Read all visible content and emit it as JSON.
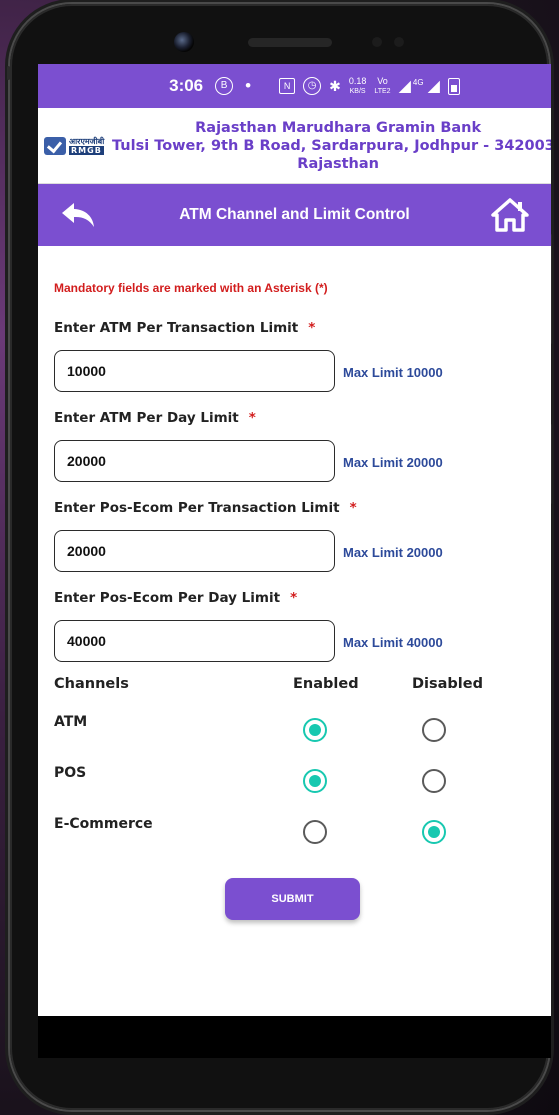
{
  "statusbar": {
    "time": "3:06",
    "b_icon": "B",
    "dot": "•",
    "icons": [
      "nfc-icon",
      "alarm-icon",
      "bluetooth-icon",
      "data-speed",
      "volte-icon",
      "signal-icon",
      "battery-icon"
    ],
    "speed_value": "0.18",
    "speed_unit": "KB/S",
    "volte_top": "Vo",
    "volte_bottom": "LTE2",
    "network": "4G"
  },
  "bank": {
    "logo_hindi": "आरएमजीबी",
    "logo_text": "RMGB",
    "name": "Rajasthan Marudhara Gramin Bank",
    "address_line1": "Tulsi Tower, 9th B Road, Sardarpura, Jodhpur - 342003,",
    "address_line2": "Rajasthan"
  },
  "topbar": {
    "title": "ATM Channel and Limit Control"
  },
  "form": {
    "mandatory_note": "Mandatory fields are marked with an Asterisk (*)",
    "asterisk": "*",
    "fields": [
      {
        "label": "Enter ATM Per Transaction Limit",
        "value": "10000",
        "max_limit": "Max Limit 10000"
      },
      {
        "label": "Enter ATM Per Day Limit",
        "value": "20000",
        "max_limit": "Max Limit 20000"
      },
      {
        "label": "Enter Pos-Ecom Per Transaction Limit",
        "value": "20000",
        "max_limit": "Max Limit 20000"
      },
      {
        "label": "Enter Pos-Ecom Per Day Limit",
        "value": "40000",
        "max_limit": "Max Limit 40000"
      }
    ]
  },
  "channels": {
    "header_channels": "Channels",
    "header_enabled": "Enabled",
    "header_disabled": "Disabled",
    "rows": [
      {
        "name": "ATM",
        "selected": "enabled"
      },
      {
        "name": "POS",
        "selected": "enabled"
      },
      {
        "name": "E-Commerce",
        "selected": "disabled"
      }
    ]
  },
  "submit_label": "SUBMIT",
  "colors": {
    "brand": "#7b4fd0",
    "radio_on": "#17c8b0",
    "mandatory": "#d21d1d",
    "max_limit": "#2d4a9a"
  }
}
